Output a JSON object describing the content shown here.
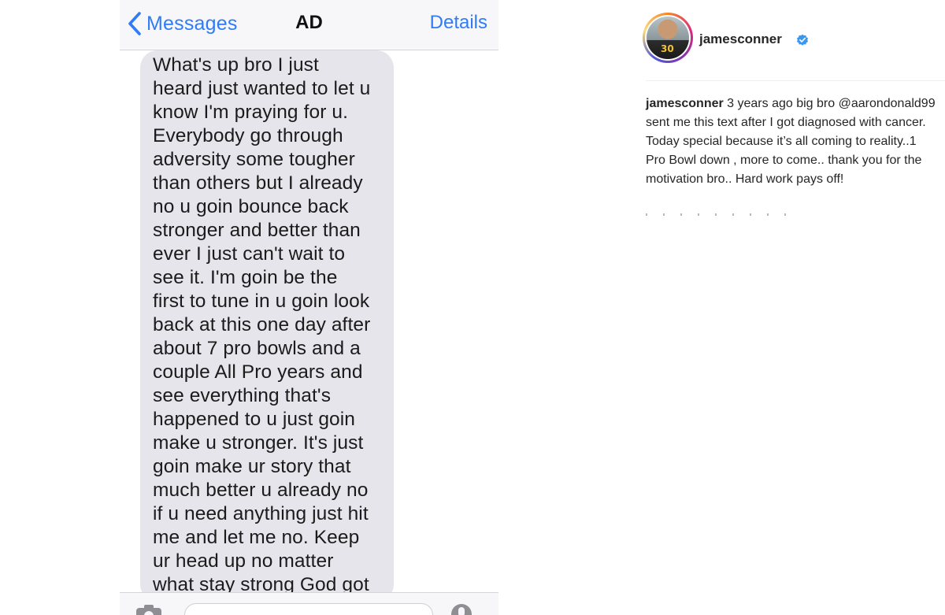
{
  "imessage": {
    "back_label": "Messages",
    "contact_name": "AD",
    "details_label": "Details",
    "message_text": "What's up bro I just\nheard just wanted to let u\nknow I'm praying for u.\nEverybody go through\nadversity some tougher\nthan others but I already\nno u goin bounce back\nstronger and better than\never I just can't wait to\nsee it. I'm goin be the\nfirst to tune in u goin look\nback at this one day after\nabout 7 pro bowls and a\ncouple All Pro years and\nsee everything that's\nhappened to u just goin\nmake u stronger. It's just\ngoin make ur story that\nmuch better u already no\nif u need anything just hit\nme and let me no. Keep\nur head up no matter\nwhat stay strong God got",
    "accent_color": "#2f7cf6",
    "bubble_color": "#e6e5eb",
    "icons": [
      "chevron-left-icon",
      "camera-icon",
      "mic-icon"
    ]
  },
  "instagram": {
    "username": "jamesconner",
    "jersey_number": "30",
    "verified": true,
    "caption_user": "jamesconner",
    "caption_before_mention": " 3 years ago big bro ",
    "mention": "@aarondonald99",
    "caption_after_mention": " sent me this text after I got diagnosed with cancer. Today special because it’s all coming to reality..1 Pro Bowl down , more to come.. thank you for the motivation bro.. Hard work pays off!",
    "verified_color": "#3897f0",
    "icons": [
      "verified-badge-icon"
    ]
  }
}
